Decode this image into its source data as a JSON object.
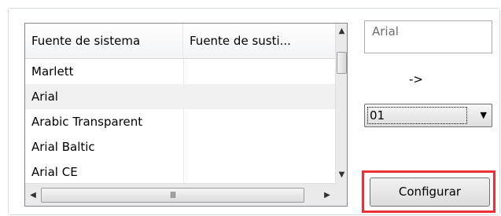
{
  "list": {
    "columns": [
      "Fuente de sistema",
      "Fuente de susti..."
    ],
    "rows": [
      {
        "system_font": "Marlett",
        "substitute": "",
        "selected": false
      },
      {
        "system_font": "Arial",
        "substitute": "",
        "selected": true
      },
      {
        "system_font": "Arabic Transparent",
        "substitute": "",
        "selected": false
      },
      {
        "system_font": "Arial Baltic",
        "substitute": "",
        "selected": false
      },
      {
        "system_font": "Arial CE",
        "substitute": "",
        "selected": false
      }
    ],
    "hscroll_grip": "III"
  },
  "font_input": {
    "value": "Arial"
  },
  "arrow_label": "->",
  "select": {
    "value": "01"
  },
  "configure_button": {
    "label": "Configurar"
  },
  "colors": {
    "highlight": "#e8313a",
    "selected_row": "#f0f0f0"
  }
}
